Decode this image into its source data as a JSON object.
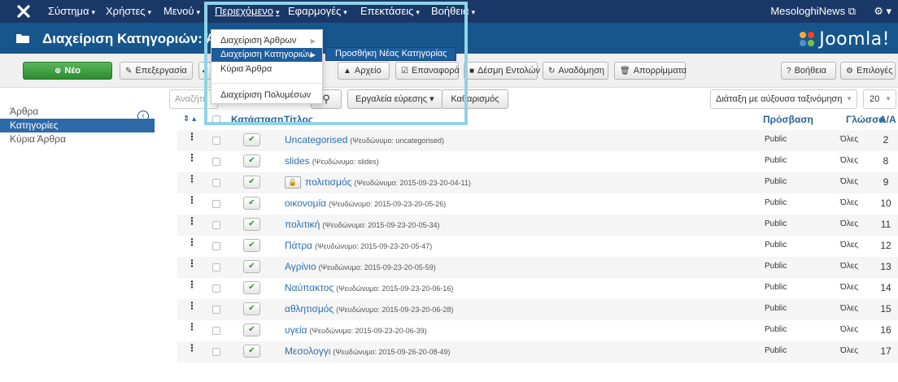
{
  "nav": {
    "system": "Σύστημα",
    "users": "Χρήστες",
    "menus": "Μενού",
    "content": "Περιεχόμενο",
    "apps": "Εφαρμογές",
    "extensions": "Επεκτάσεις",
    "help": "Βοήθεια",
    "site_name": "MesologhiNews",
    "caret": "▾",
    "external_icon": "⧉",
    "gear_icon": "⚙"
  },
  "header": {
    "title": "Διαχείριση Κατηγοριών: Άρθ",
    "brand": "Joomla!"
  },
  "toolbar": {
    "new": "Νέο",
    "edit": "Επεξεργασία",
    "archive": "Αρχείο",
    "checkin": "Επαναφορά",
    "batch": "Δέσμη Εντολών",
    "rebuild": "Αναδόμηση",
    "trash": "Απορρίμματα",
    "help": "Βοήθεια",
    "options": "Επιλογές"
  },
  "sidebar": {
    "items": [
      {
        "label": "Άρθρα"
      },
      {
        "label": "Κατηγορίες"
      },
      {
        "label": "Κύρια Άρθρα"
      }
    ],
    "active_index": 1
  },
  "filters": {
    "search_placeholder": "Αναζήτη",
    "search_tools": "Εργαλεία εύρεσης",
    "clear": "Καθαρισμός",
    "sort": "Διάταξη με αύξουσα ταξινόμηση",
    "limit": "20"
  },
  "table": {
    "headers": {
      "status": "Κατάσταση",
      "title": "Τίτλος",
      "access": "Πρόσβαση",
      "language": "Γλώσσα",
      "id": "Α/Α"
    },
    "rows": [
      {
        "title": "Uncategorised",
        "alias": "(Ψευδώνυμο: uncategorised)",
        "access": "Public",
        "language": "Όλες",
        "id": "2",
        "locked": false
      },
      {
        "title": "slides",
        "alias": "(Ψευδώνυμο: slides)",
        "access": "Public",
        "language": "Όλες",
        "id": "8",
        "locked": false
      },
      {
        "title": "πολιτισμός",
        "alias": "(Ψευδώνυμο: 2015-09-23-20-04-11)",
        "access": "Public",
        "language": "Όλες",
        "id": "9",
        "locked": true
      },
      {
        "title": "οικονομία",
        "alias": "(Ψευδώνυμο: 2015-09-23-20-05-26)",
        "access": "Public",
        "language": "Όλες",
        "id": "10",
        "locked": false
      },
      {
        "title": "πολιτική",
        "alias": "(Ψευδώνυμο: 2015-09-23-20-05-34)",
        "access": "Public",
        "language": "Όλες",
        "id": "11",
        "locked": false
      },
      {
        "title": "Πάτρα",
        "alias": "(Ψευδώνυμο: 2015-09-23-20-05-47)",
        "access": "Public",
        "language": "Όλες",
        "id": "12",
        "locked": false
      },
      {
        "title": "Αγρίνιο",
        "alias": "(Ψευδώνυμο: 2015-09-23-20-05-59)",
        "access": "Public",
        "language": "Όλες",
        "id": "13",
        "locked": false
      },
      {
        "title": "Ναύπακτος",
        "alias": "(Ψευδώνυμο: 2015-09-23-20-06-16)",
        "access": "Public",
        "language": "Όλες",
        "id": "14",
        "locked": false
      },
      {
        "title": "αθλητισμός",
        "alias": "(Ψευδώνυμο: 2015-09-23-20-06-28)",
        "access": "Public",
        "language": "Όλες",
        "id": "15",
        "locked": false
      },
      {
        "title": "υγεία",
        "alias": "(Ψευδώνυμο: 2015-09-23-20-06-39)",
        "access": "Public",
        "language": "Όλες",
        "id": "16",
        "locked": false
      },
      {
        "title": "Μεσολογγι",
        "alias": "(Ψευδώνυμο: 2015-09-26-20-08-49)",
        "access": "Public",
        "language": "Όλες",
        "id": "17",
        "locked": false
      }
    ]
  },
  "dropdown": {
    "items": [
      {
        "label": "Διαχείριση Άρθρων",
        "has_submenu": true
      },
      {
        "label": "Διαχείριση Κατηγοριών",
        "has_submenu": true
      },
      {
        "label": "Κύρια Άρθρα",
        "has_submenu": false
      },
      {
        "label": "Διαχείριση Πολυμέσων",
        "has_submenu": false
      }
    ],
    "active_index": 1,
    "submenu_item": "Προσθήκη Νέας Κατηγορίας"
  },
  "colors": {
    "navbar": "#1a3867",
    "header": "#17568c",
    "accent": "#2e6aa8",
    "link": "#2a6fb2",
    "new_button": "#3c9a3e",
    "highlight_frame": "#8fd3e8"
  }
}
